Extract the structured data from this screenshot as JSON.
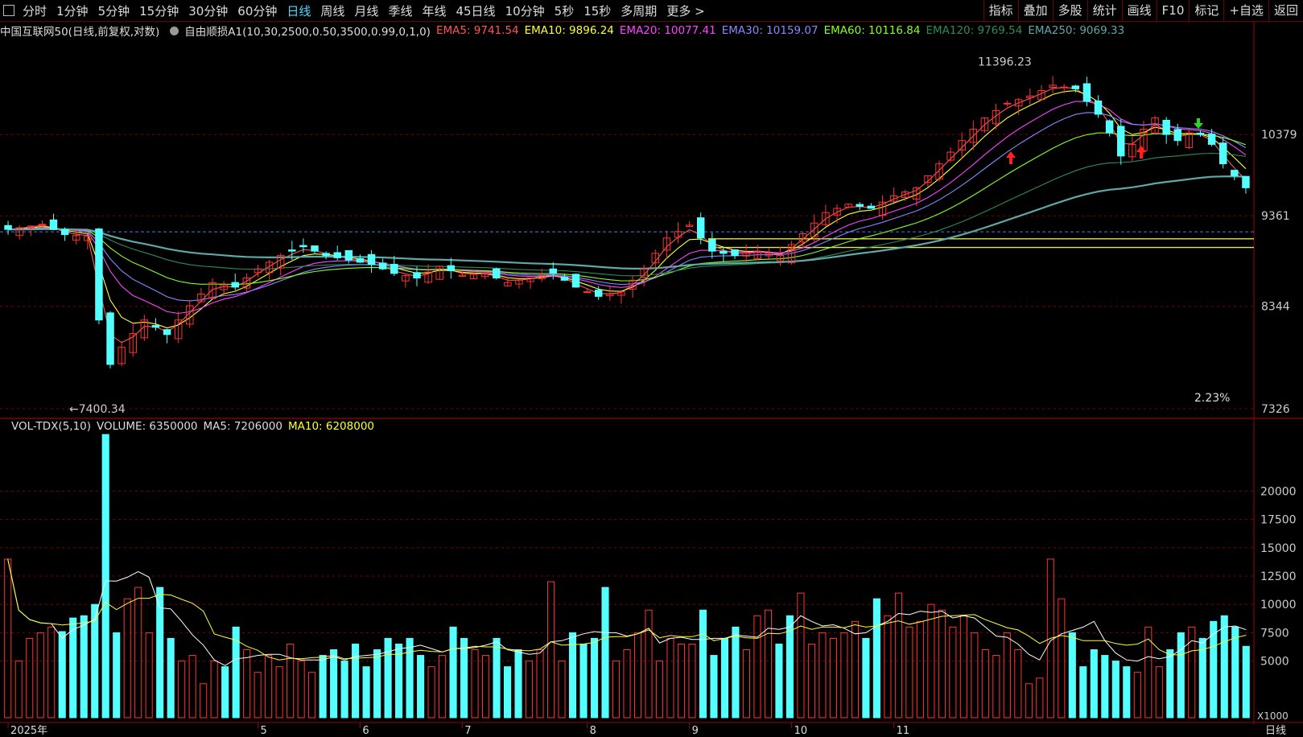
{
  "topbar": {
    "periods": [
      "分时",
      "1分钟",
      "5分钟",
      "15分钟",
      "30分钟",
      "60分钟",
      "日线",
      "周线",
      "月线",
      "季线",
      "年线",
      "45日线",
      "10分钟",
      "5秒",
      "15秒",
      "多周期",
      "更多 >"
    ],
    "active": "日线",
    "right_buttons": [
      "指标",
      "叠加",
      "多股",
      "统计",
      "画线",
      "F10",
      "标记",
      "+自选",
      "返回"
    ]
  },
  "legend": {
    "title": "中国互联网50(日线,前复权,对数)",
    "indicator": "自由顺损A1(10,30,2500,0.50,3500,0.99,0,1,0)",
    "ema": [
      {
        "label": "EMA5: 9741.54",
        "color": "#ff5555"
      },
      {
        "label": "EMA10: 9896.24",
        "color": "#ffff33"
      },
      {
        "label": "EMA20: 10077.41",
        "color": "#ff44ff"
      },
      {
        "label": "EMA30: 10159.07",
        "color": "#8888ff"
      },
      {
        "label": "EMA60: 10116.84",
        "color": "#88ff22"
      },
      {
        "label": "EMA120: 9769.54",
        "color": "#2e8b57"
      },
      {
        "label": "EMA250: 9069.33",
        "color": "#5fa8a8"
      }
    ]
  },
  "annotations": {
    "high": "11396.23",
    "low": "←7400.34",
    "pct": "2.23%"
  },
  "volume_legend": {
    "name": "VOL-TDX(5,10)",
    "volume": "VOLUME: 6350000",
    "ma5": "MA5: 7206000",
    "ma10": "MA10: 6208000"
  },
  "bottom_right": "日线",
  "vol_unit": "X1000",
  "colors": {
    "up": "#ff3232",
    "down": "#54ffff",
    "grid": "#7a0000",
    "axis": "#a00000"
  },
  "chart_data": [
    {
      "type": "candlestick",
      "scale": "log",
      "ylim": [
        7326,
        11700
      ],
      "y_ticks": [
        10379,
        9361,
        8344,
        7326
      ],
      "x_ticks": [
        "2025年",
        "5",
        "6",
        "7",
        "8",
        "9",
        "10",
        "11"
      ],
      "x_tick_index": [
        0,
        22,
        31,
        40,
        51,
        60,
        69,
        78
      ],
      "n_bars": 110,
      "levels": [
        9172,
        9091,
        8992
      ],
      "high_value": 11396.23,
      "low_value": 7400.34,
      "close_path": [
        [
          0,
          9200
        ],
        [
          3,
          9260
        ],
        [
          5,
          9140
        ],
        [
          7,
          9120
        ],
        [
          8,
          8200
        ],
        [
          9,
          7750
        ],
        [
          10,
          7920
        ],
        [
          12,
          8200
        ],
        [
          14,
          8050
        ],
        [
          16,
          8350
        ],
        [
          18,
          8600
        ],
        [
          20,
          8550
        ],
        [
          22,
          8750
        ],
        [
          24,
          8900
        ],
        [
          26,
          9000
        ],
        [
          28,
          8900
        ],
        [
          30,
          8850
        ],
        [
          32,
          8800
        ],
        [
          34,
          8700
        ],
        [
          36,
          8650
        ],
        [
          38,
          8780
        ],
        [
          40,
          8680
        ],
        [
          42,
          8700
        ],
        [
          44,
          8600
        ],
        [
          46,
          8650
        ],
        [
          48,
          8700
        ],
        [
          50,
          8550
        ],
        [
          52,
          8450
        ],
        [
          54,
          8500
        ],
        [
          56,
          8750
        ],
        [
          58,
          9100
        ],
        [
          60,
          9250
        ],
        [
          62,
          8950
        ],
        [
          64,
          8900
        ],
        [
          66,
          8950
        ],
        [
          68,
          8900
        ],
        [
          70,
          9150
        ],
        [
          72,
          9400
        ],
        [
          74,
          9500
        ],
        [
          76,
          9450
        ],
        [
          78,
          9600
        ],
        [
          80,
          9700
        ],
        [
          82,
          10000
        ],
        [
          84,
          10300
        ],
        [
          86,
          10600
        ],
        [
          88,
          10800
        ],
        [
          90,
          10900
        ],
        [
          92,
          11050
        ],
        [
          94,
          11000
        ],
        [
          96,
          10650
        ],
        [
          97,
          10400
        ],
        [
          98,
          10100
        ],
        [
          99,
          10250
        ],
        [
          100,
          10450
        ],
        [
          101,
          10600
        ],
        [
          102,
          10380
        ],
        [
          103,
          10300
        ],
        [
          104,
          10400
        ],
        [
          105,
          10380
        ],
        [
          106,
          10250
        ],
        [
          107,
          10000
        ],
        [
          108,
          9850
        ],
        [
          109,
          9700
        ],
        [
          110,
          9600
        ]
      ],
      "ema_series": [
        {
          "name": "EMA5",
          "color": "#ff5555",
          "lag": 1
        },
        {
          "name": "EMA10",
          "color": "#ffff33",
          "lag": 2
        },
        {
          "name": "EMA20",
          "color": "#ff44ff",
          "lag": 4
        },
        {
          "name": "EMA30",
          "color": "#8888ff",
          "lag": 6
        },
        {
          "name": "EMA60",
          "color": "#88ff22",
          "lag": 10
        },
        {
          "name": "EMA120",
          "color": "#2e8b57",
          "lag": 18
        },
        {
          "name": "EMA250",
          "color": "#5fa8a8",
          "lag": 30
        }
      ]
    },
    {
      "type": "bar",
      "name": "VOLUME",
      "ylim": [
        0,
        25000
      ],
      "y_ticks": [
        20000,
        17500,
        15000,
        12500,
        10000,
        7500,
        5000
      ],
      "unit": "X1000",
      "values": [
        14000,
        5000,
        7000,
        7500,
        8000,
        7600,
        8800,
        9000,
        10000,
        25000,
        7500,
        10500,
        11500,
        7500,
        11500,
        7000,
        5000,
        5500,
        3000,
        5000,
        4500,
        8000,
        6000,
        4000,
        5500,
        4500,
        6500,
        5000,
        4000,
        5500,
        6000,
        5000,
        6500,
        4500,
        6000,
        7000,
        6500,
        7000,
        5500,
        4500,
        5500,
        8000,
        7000,
        6000,
        5500,
        7000,
        4500,
        6000,
        5000,
        6000,
        12000,
        5000,
        7500,
        6500,
        7000,
        11500,
        5000,
        6000,
        7500,
        9500,
        5000,
        7000,
        6500,
        6500,
        9500,
        5500,
        7000,
        8000,
        6000,
        9000,
        9500,
        6500,
        9000,
        11000,
        6500,
        7500,
        7000,
        7500,
        8500,
        7000,
        10500,
        9000,
        11000,
        8000,
        8500,
        10000,
        9500,
        8000,
        9000,
        7500,
        6000,
        5500,
        7500,
        6000,
        3000,
        3500,
        14000,
        10500,
        7500,
        4500,
        6000,
        5500,
        5000,
        4500,
        4000,
        8000,
        4500,
        6000,
        7500,
        8000,
        7000,
        8500,
        9000,
        8000,
        6300
      ]
    }
  ]
}
